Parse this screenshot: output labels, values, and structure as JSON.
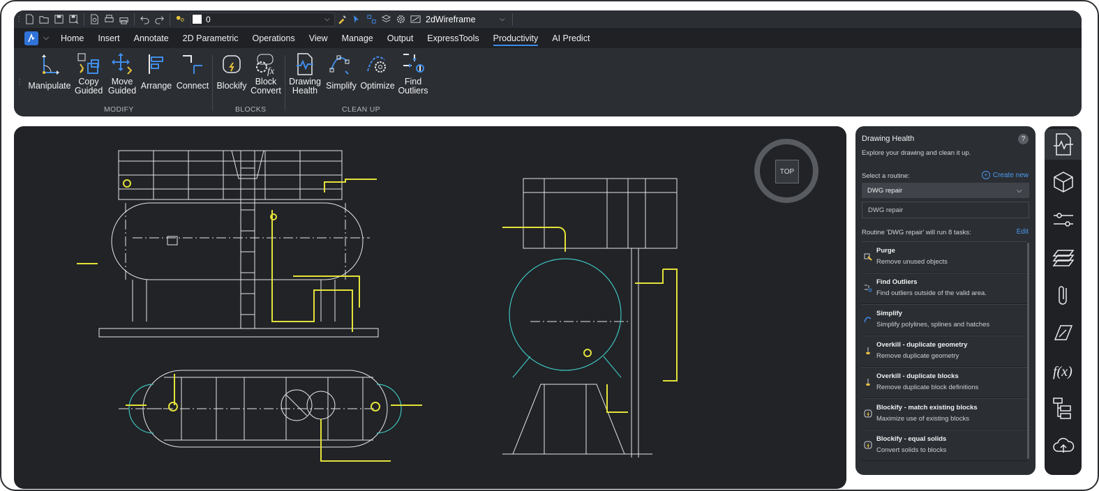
{
  "qat": {
    "layer_value": "0",
    "visual_style": "2dWireframe",
    "icons": [
      "new-icon",
      "open-icon",
      "save-icon",
      "save-as-icon",
      "preview-icon",
      "print-icon",
      "plot-icon",
      "undo-icon",
      "redo-icon",
      "layer-state-icon",
      "match-properties-icon",
      "select-icon",
      "properties-icon",
      "layers-icon",
      "settings-icon",
      "visual-style-icon"
    ]
  },
  "tabs": [
    "Home",
    "Insert",
    "Annotate",
    "2D Parametric",
    "Operations",
    "View",
    "Manage",
    "Output",
    "ExpressTools",
    "Productivity",
    "AI Predict"
  ],
  "active_tab": "Productivity",
  "ribbon": {
    "modify": {
      "label": "MODIFY",
      "buttons": [
        "Manipulate",
        "Copy\nGuided",
        "Move\nGuided",
        "Arrange",
        "Connect"
      ]
    },
    "blocks": {
      "label": "BLOCKS",
      "buttons": [
        "Blockify",
        "Block\nConvert"
      ]
    },
    "cleanup": {
      "label": "CLEAN UP",
      "buttons": [
        "Drawing\nHealth",
        "Simplify",
        "Optimize",
        "Find\nOutliers"
      ]
    }
  },
  "viewcube": {
    "face": "TOP"
  },
  "drawing_health": {
    "title": "Drawing Health",
    "help": "?",
    "subtitle": "Explore your drawing and clean it up.",
    "select_label": "Select a routine:",
    "create_new": "Create new",
    "routine_selected": "DWG repair",
    "routine_name_value": "DWG repair",
    "routine_summary": "Routine 'DWG repair' will run 8 tasks:",
    "edit": "Edit",
    "tasks": [
      {
        "title": "Purge",
        "desc": "Remove unused objects",
        "icon": "purge-icon"
      },
      {
        "title": "Find Outliers",
        "desc": "Find outliers outside of the valid area.",
        "icon": "find-outliers-icon"
      },
      {
        "title": "Simplify",
        "desc": "Simplify polylines, splines and hatches",
        "icon": "simplify-icon"
      },
      {
        "title": "Overkill - duplicate geometry",
        "desc": "Remove duplicate geometry",
        "icon": "overkill-icon"
      },
      {
        "title": "Overkill - duplicate blocks",
        "desc": "Remove duplicate block definitions",
        "icon": "overkill-icon"
      },
      {
        "title": "Blockify - match existing blocks",
        "desc": "Maximize use of existing blocks",
        "icon": "blockify-icon"
      },
      {
        "title": "Blockify - equal solids",
        "desc": "Convert solids to blocks",
        "icon": "blockify-icon"
      }
    ]
  },
  "right_bar": [
    "drawing-health-icon",
    "structure-icon",
    "properties-sliders-icon",
    "layers-icon",
    "attachments-icon",
    "draw-order-icon",
    "parameters-fx-icon",
    "hierarchy-icon",
    "cloud-upload-icon"
  ],
  "colors": {
    "accent": "#3d8be8",
    "link": "#4b9bf2",
    "linework": "#e8e8e8",
    "highlight": "#e4e23a",
    "cyan": "#3fc4bf",
    "canvas": "#212327",
    "panel": "#2b2e33"
  }
}
